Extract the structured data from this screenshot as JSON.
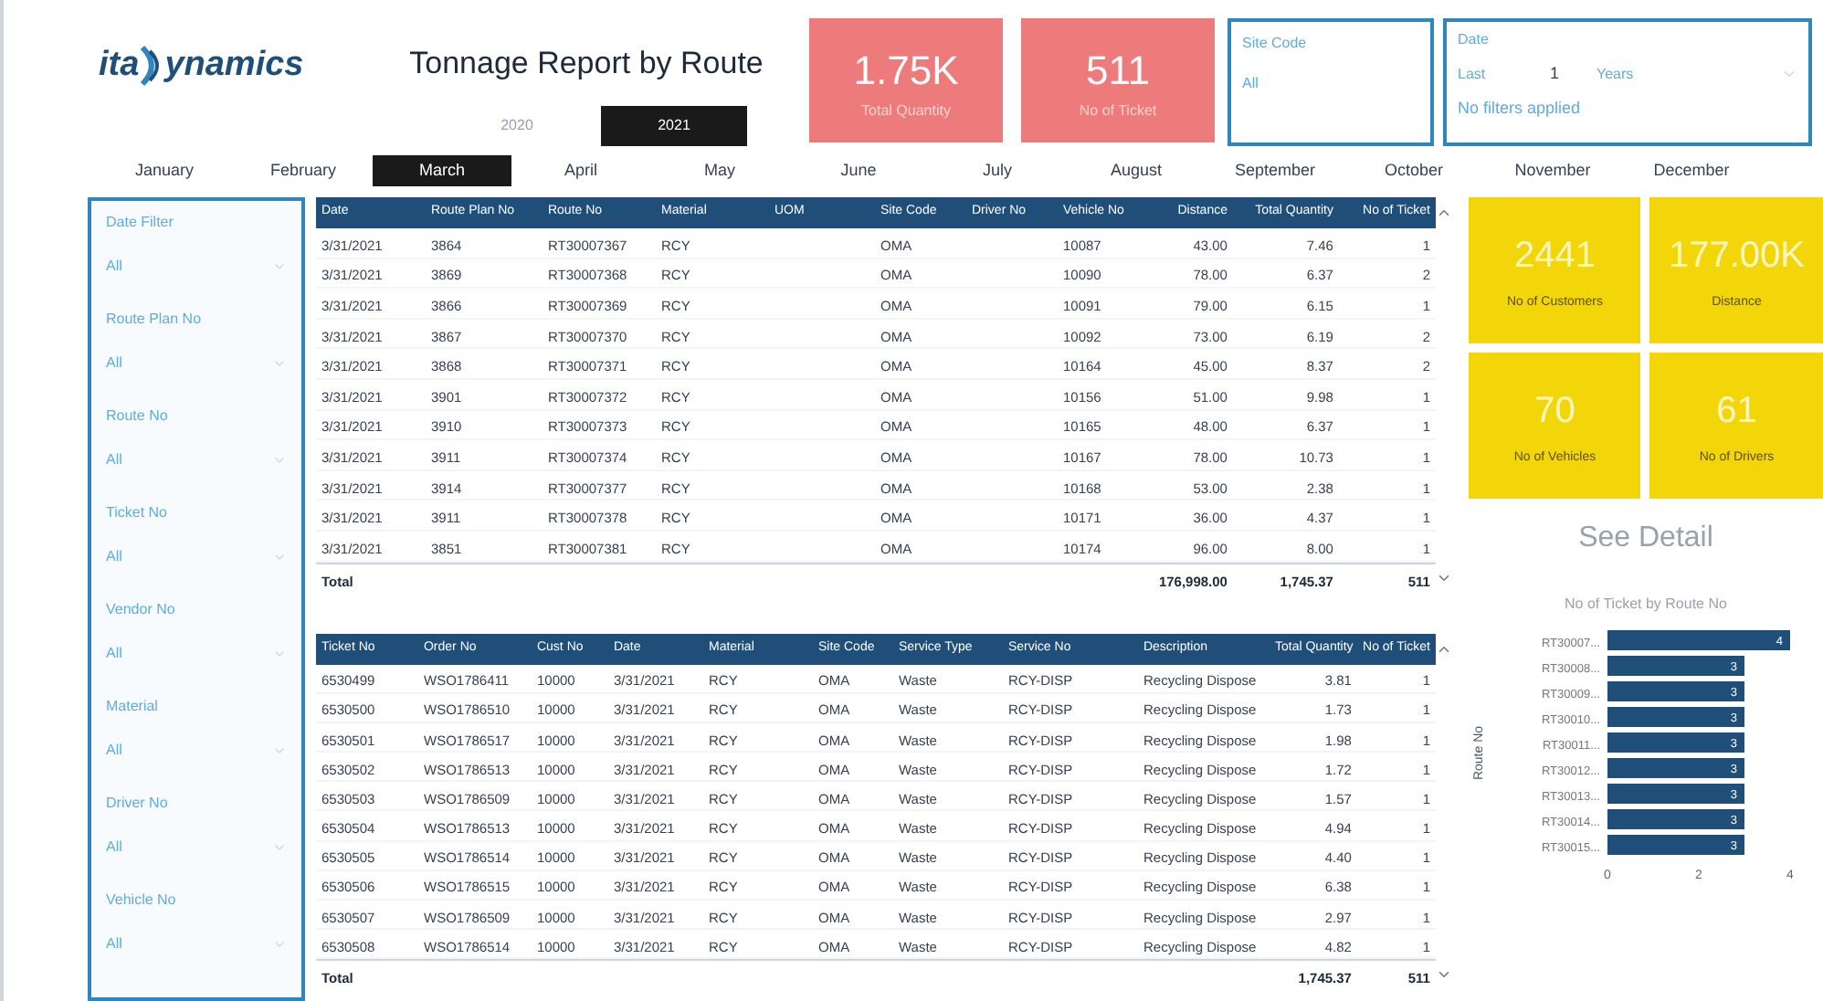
{
  "logo": {
    "left": "ita",
    "right": "ynamics"
  },
  "title": "Tonnage Report by Route",
  "years": [
    {
      "label": "2020",
      "selected": false
    },
    {
      "label": "2021",
      "selected": true
    }
  ],
  "kpis": [
    {
      "value": "1.75K",
      "label": "Total Quantity"
    },
    {
      "value": "511",
      "label": "No of Ticket"
    }
  ],
  "site_slicer": {
    "title": "Site Code",
    "value": "All"
  },
  "date_slicer": {
    "title": "Date",
    "mode": "Last",
    "count": "1",
    "unit": "Years",
    "status": "No filters applied"
  },
  "months": [
    {
      "label": "January",
      "selected": false
    },
    {
      "label": "February",
      "selected": false
    },
    {
      "label": "March",
      "selected": true
    },
    {
      "label": "April",
      "selected": false
    },
    {
      "label": "May",
      "selected": false
    },
    {
      "label": "June",
      "selected": false
    },
    {
      "label": "July",
      "selected": false
    },
    {
      "label": "August",
      "selected": false
    },
    {
      "label": "September",
      "selected": false
    },
    {
      "label": "October",
      "selected": false
    },
    {
      "label": "November",
      "selected": false
    },
    {
      "label": "December",
      "selected": false
    }
  ],
  "filters": [
    {
      "label": "Date Filter",
      "value": "All"
    },
    {
      "label": "Route Plan No",
      "value": "All"
    },
    {
      "label": "Route No",
      "value": "All"
    },
    {
      "label": "Ticket No",
      "value": "All"
    },
    {
      "label": "Vendor No",
      "value": "All"
    },
    {
      "label": "Material",
      "value": "All"
    },
    {
      "label": "Driver No",
      "value": "All"
    },
    {
      "label": "Vehicle No",
      "value": "All"
    }
  ],
  "route_table": {
    "columns": [
      "Date",
      "Route Plan No",
      "Route No",
      "Material",
      "UOM",
      "Site Code",
      "Driver No",
      "Vehicle No",
      "Distance",
      "Total Quantity",
      "No of Ticket"
    ],
    "rows": [
      [
        "3/31/2021",
        "3864",
        "RT30007367",
        "RCY",
        null,
        "OMA",
        null,
        "10087",
        "43.00",
        "7.46",
        "1"
      ],
      [
        "3/31/2021",
        "3869",
        "RT30007368",
        "RCY",
        null,
        "OMA",
        null,
        "10090",
        "78.00",
        "6.37",
        "2"
      ],
      [
        "3/31/2021",
        "3866",
        "RT30007369",
        "RCY",
        null,
        "OMA",
        null,
        "10091",
        "79.00",
        "6.15",
        "1"
      ],
      [
        "3/31/2021",
        "3867",
        "RT30007370",
        "RCY",
        null,
        "OMA",
        null,
        "10092",
        "73.00",
        "6.19",
        "2"
      ],
      [
        "3/31/2021",
        "3868",
        "RT30007371",
        "RCY",
        null,
        "OMA",
        null,
        "10164",
        "45.00",
        "8.37",
        "2"
      ],
      [
        "3/31/2021",
        "3901",
        "RT30007372",
        "RCY",
        null,
        "OMA",
        null,
        "10156",
        "51.00",
        "9.98",
        "1"
      ],
      [
        "3/31/2021",
        "3910",
        "RT30007373",
        "RCY",
        null,
        "OMA",
        null,
        "10165",
        "48.00",
        "6.37",
        "1"
      ],
      [
        "3/31/2021",
        "3911",
        "RT30007374",
        "RCY",
        null,
        "OMA",
        null,
        "10167",
        "78.00",
        "10.73",
        "1"
      ],
      [
        "3/31/2021",
        "3914",
        "RT30007377",
        "RCY",
        null,
        "OMA",
        null,
        "10168",
        "53.00",
        "2.38",
        "1"
      ],
      [
        "3/31/2021",
        "3911",
        "RT30007378",
        "RCY",
        null,
        "OMA",
        null,
        "10171",
        "36.00",
        "4.37",
        "1"
      ],
      [
        "3/31/2021",
        "3851",
        "RT30007381",
        "RCY",
        null,
        "OMA",
        null,
        "10174",
        "96.00",
        "8.00",
        "1"
      ]
    ],
    "total": [
      "Total",
      "176,998.00",
      "1,745.37",
      "511"
    ]
  },
  "ticket_table": {
    "columns": [
      "Ticket No",
      "Order No",
      "Cust No",
      "Date",
      "Material",
      "Site Code",
      "Service Type",
      "Service No",
      "Description",
      "Total Quantity",
      "No of Ticket"
    ],
    "rows": [
      [
        "6530499",
        "WSO1786411",
        "10000",
        "3/31/2021",
        "RCY",
        "OMA",
        "Waste",
        "RCY-DISP",
        "Recycling Dispose",
        "3.81",
        "1"
      ],
      [
        "6530500",
        "WSO1786510",
        "10000",
        "3/31/2021",
        "RCY",
        "OMA",
        "Waste",
        "RCY-DISP",
        "Recycling Dispose",
        "1.73",
        "1"
      ],
      [
        "6530501",
        "WSO1786517",
        "10000",
        "3/31/2021",
        "RCY",
        "OMA",
        "Waste",
        "RCY-DISP",
        "Recycling Dispose",
        "1.98",
        "1"
      ],
      [
        "6530502",
        "WSO1786513",
        "10000",
        "3/31/2021",
        "RCY",
        "OMA",
        "Waste",
        "RCY-DISP",
        "Recycling Dispose",
        "1.72",
        "1"
      ],
      [
        "6530503",
        "WSO1786509",
        "10000",
        "3/31/2021",
        "RCY",
        "OMA",
        "Waste",
        "RCY-DISP",
        "Recycling Dispose",
        "1.57",
        "1"
      ],
      [
        "6530504",
        "WSO1786513",
        "10000",
        "3/31/2021",
        "RCY",
        "OMA",
        "Waste",
        "RCY-DISP",
        "Recycling Dispose",
        "4.94",
        "1"
      ],
      [
        "6530505",
        "WSO1786514",
        "10000",
        "3/31/2021",
        "RCY",
        "OMA",
        "Waste",
        "RCY-DISP",
        "Recycling Dispose",
        "4.40",
        "1"
      ],
      [
        "6530506",
        "WSO1786515",
        "10000",
        "3/31/2021",
        "RCY",
        "OMA",
        "Waste",
        "RCY-DISP",
        "Recycling Dispose",
        "6.38",
        "1"
      ],
      [
        "6530507",
        "WSO1786509",
        "10000",
        "3/31/2021",
        "RCY",
        "OMA",
        "Waste",
        "RCY-DISP",
        "Recycling Dispose",
        "2.97",
        "1"
      ],
      [
        "6530508",
        "WSO1786514",
        "10000",
        "3/31/2021",
        "RCY",
        "OMA",
        "Waste",
        "RCY-DISP",
        "Recycling Dispose",
        "4.82",
        "1"
      ]
    ],
    "total": [
      "Total",
      "1,745.37",
      "511"
    ]
  },
  "cards": [
    {
      "value": "2441",
      "label": "No of Customers"
    },
    {
      "value": "177.00K",
      "label": "Distance"
    },
    {
      "value": "70",
      "label": "No of Vehicles"
    },
    {
      "value": "61",
      "label": "No of Drivers"
    }
  ],
  "detail_button": "See Detail",
  "chart": {
    "chart_data": {
      "type": "bar",
      "orientation": "horizontal",
      "title": "No of Ticket by Route No",
      "ylabel": "Route No",
      "categories": [
        "RT30007...",
        "RT30008...",
        "RT30009...",
        "RT30010...",
        "RT30011...",
        "RT30012...",
        "RT30013...",
        "RT30014...",
        "RT30015..."
      ],
      "values": [
        4,
        3,
        3,
        3,
        3,
        3,
        3,
        3,
        3
      ],
      "xlim": [
        0,
        4
      ],
      "xticks": [
        0,
        2,
        4
      ],
      "data_labels": true
    }
  }
}
